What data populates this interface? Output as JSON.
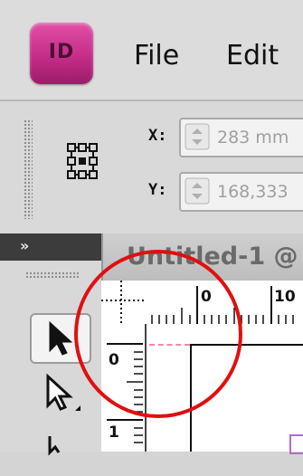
{
  "app": {
    "logo_text": "ID",
    "accent": "#c52d88"
  },
  "menu": {
    "file_label": "File",
    "edit_label": "Edit"
  },
  "control_panel": {
    "x_label": "X:",
    "x_value": "283 mm",
    "y_label": "Y:",
    "y_value": "168,333",
    "reference_point_icon": "reference-point-icon"
  },
  "tools": {
    "collapse_icon": "»",
    "items": [
      {
        "name": "selection-tool",
        "icon": "arrow-black-icon",
        "active": true
      },
      {
        "name": "direct-selection-tool",
        "icon": "arrow-white-icon",
        "active": false
      },
      {
        "name": "page-tool",
        "icon": "page-tool-icon",
        "active": false
      }
    ]
  },
  "document": {
    "tab_title": "Untitled-1 @",
    "ruler_h_labels": [
      "0",
      "10"
    ],
    "ruler_v_labels": [
      "0",
      "1"
    ]
  },
  "annotation": {
    "circle_color": "#e01010"
  }
}
